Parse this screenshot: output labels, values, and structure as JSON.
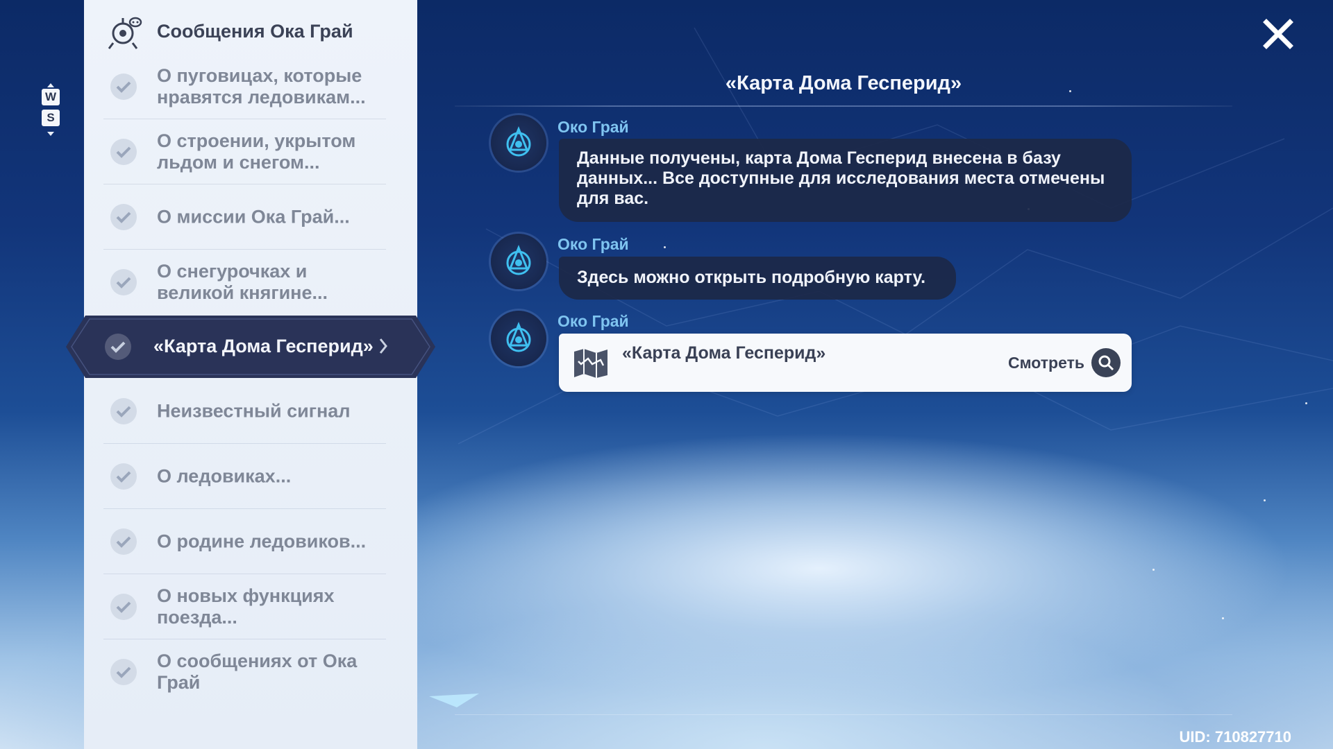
{
  "header": {
    "title": "Сообщения Ока Грай",
    "icon": "eye-device-icon"
  },
  "compass": {
    "up_key": "W",
    "down_key": "S"
  },
  "sidebar": {
    "items": [
      {
        "label": "О пуговицах, которые нравятся ледовикам...",
        "read": true
      },
      {
        "label": "О строении, укрытом льдом и снегом...",
        "read": true
      },
      {
        "label": "О миссии Ока Грай...",
        "read": true
      },
      {
        "label": "О снегурочках и великой княгине...",
        "read": true
      },
      {
        "label": "«Карта Дома Гесперид»",
        "read": true,
        "selected": true
      },
      {
        "label": "Неизвестный сигнал",
        "read": true
      },
      {
        "label": "О ледовиках...",
        "read": true
      },
      {
        "label": "О родине ледовиков...",
        "read": true
      },
      {
        "label": "О новых функциях поезда...",
        "read": true
      },
      {
        "label": "О сообщениях от Ока Грай",
        "read": true
      }
    ]
  },
  "chat": {
    "title": "«Карта Дома Гесперид»",
    "messages": [
      {
        "sender": "Око Грай",
        "text": "Данные получены, карта Дома Гесперид внесена в базу данных... Все доступные для исследования места отмечены для вас."
      },
      {
        "sender": "Око Грай",
        "text": "Здесь можно открыть подробную карту."
      },
      {
        "sender": "Око Грай",
        "card": {
          "title": "«Карта Дома Гесперид»",
          "action_label": "Смотреть",
          "icon": "map-icon"
        }
      }
    ]
  },
  "uid": "UID: 710827710",
  "colors": {
    "sender": "#7fc4f0",
    "bubble": "#1c2848",
    "selected": "#2a3358",
    "sidebar": "#eef3fa"
  }
}
